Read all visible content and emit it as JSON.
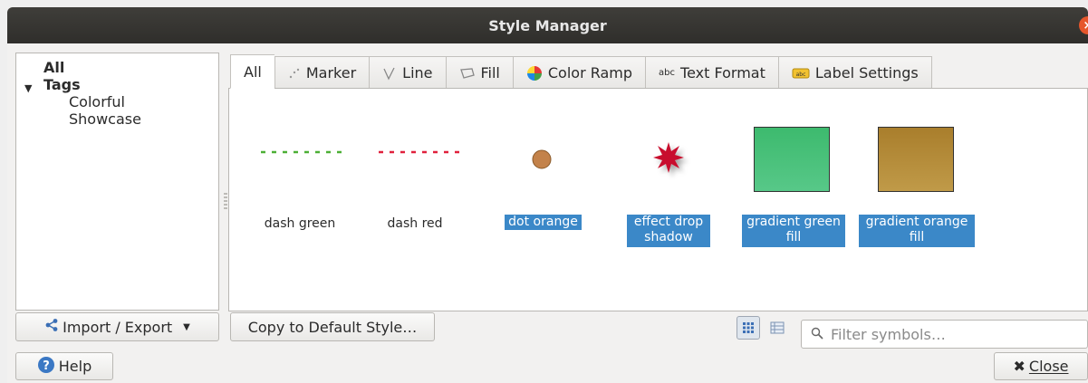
{
  "window": {
    "title": "Style Manager"
  },
  "tree": {
    "all_label": "All",
    "tags_label": "Tags",
    "tags": [
      "Colorful",
      "Showcase"
    ]
  },
  "tabs": [
    {
      "label": "All",
      "icon": "none",
      "active": true
    },
    {
      "label": "Marker",
      "icon": "marker-icon"
    },
    {
      "label": "Line",
      "icon": "line-icon"
    },
    {
      "label": "Fill",
      "icon": "fill-icon"
    },
    {
      "label": "Color Ramp",
      "icon": "color-ramp-icon"
    },
    {
      "label": "Text Format",
      "icon": "text-format-icon"
    },
    {
      "label": "Label Settings",
      "icon": "label-settings-icon"
    }
  ],
  "symbols": [
    {
      "label": "dash green",
      "selected": false,
      "color": "#4caf35"
    },
    {
      "label": "dash red",
      "selected": false,
      "color": "#e0213c"
    },
    {
      "label": "dot orange",
      "selected": true,
      "color": "#c3824a"
    },
    {
      "label": "effect drop shadow",
      "selected": true,
      "color": "#c8102e"
    },
    {
      "label": "gradient green fill",
      "selected": true,
      "color": "#3dba6e"
    },
    {
      "label": "gradient orange fill",
      "selected": true,
      "color": "#b08a35"
    }
  ],
  "buttons": {
    "import_export": "Import / Export",
    "copy_default": "Copy to Default Style…",
    "help": "Help",
    "close": "Close"
  },
  "filter": {
    "placeholder": "Filter symbols…"
  },
  "colors": {
    "selection": "#3b88c8",
    "titlebar": "#383734"
  }
}
